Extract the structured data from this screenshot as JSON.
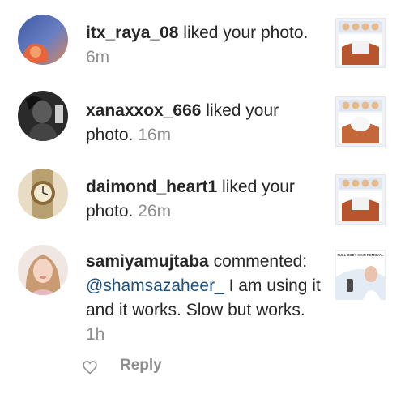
{
  "notifications": [
    {
      "username": "itx_raya_08",
      "action": " liked your photo.",
      "time": "6m"
    },
    {
      "username": "xanaxxox_666",
      "action": " liked your photo.",
      "time": "16m"
    },
    {
      "username": "daimond_heart1",
      "action": " liked your photo.",
      "time": "26m"
    },
    {
      "username": "samiyamujtaba",
      "action": " commented:",
      "mention": "@shamsazaheer_",
      "comment": " I am using it and it works. Slow but works.",
      "time": "1h"
    }
  ],
  "comment_actions": {
    "reply_label": "Reply",
    "heart_icon": "heart-outline-icon"
  },
  "thumbnail_text": "FULL BODY HAIR REMOVAL",
  "colors": {
    "text": "#262626",
    "secondary": "#8e8e8e",
    "mention": "#1f4f7b"
  }
}
